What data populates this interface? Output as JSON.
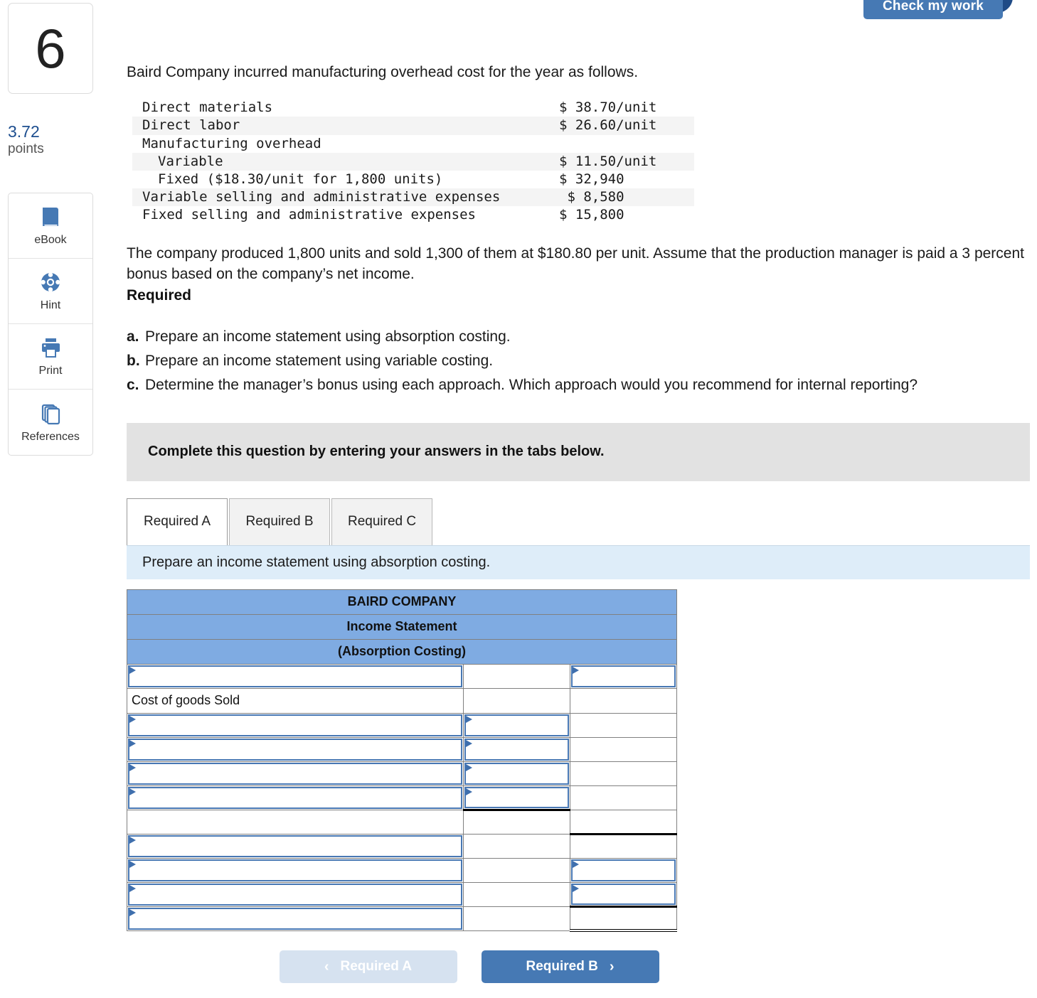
{
  "question": {
    "number": "6",
    "points_value": "3.72",
    "points_label": "points"
  },
  "check_my_work": {
    "label": "Check my work"
  },
  "sidebar": {
    "items": [
      {
        "label": "eBook",
        "icon": "ebook-icon"
      },
      {
        "label": "Hint",
        "icon": "life-ring-icon"
      },
      {
        "label": "Print",
        "icon": "printer-icon"
      },
      {
        "label": "References",
        "icon": "documents-icon"
      }
    ]
  },
  "prompt": {
    "intro": "Baird Company incurred manufacturing overhead cost for the year as follows.",
    "facts": [
      {
        "label": "Direct materials",
        "amount": "$ 38.70/unit",
        "indent": 0,
        "shade": false
      },
      {
        "label": "Direct labor",
        "amount": "$ 26.60/unit",
        "indent": 0,
        "shade": true
      },
      {
        "label": "Manufacturing overhead",
        "amount": "",
        "indent": 0,
        "shade": false
      },
      {
        "label": "Variable",
        "amount": "$ 11.50/unit",
        "indent": 1,
        "shade": true
      },
      {
        "label": "Fixed ($18.30/unit for 1,800 units)",
        "amount": "$ 32,940",
        "indent": 1,
        "shade": false
      },
      {
        "label": "Variable selling and administrative expenses",
        "amount": " $ 8,580",
        "indent": 0,
        "shade": true
      },
      {
        "label": "Fixed selling and administrative expenses",
        "amount": "$ 15,800",
        "indent": 0,
        "shade": false
      }
    ],
    "paragraph": "The company produced 1,800 units and sold 1,300 of them at $180.80 per unit. Assume that the production manager is paid a 3 percent bonus based on the company’s net income.",
    "required_heading": "Required",
    "requirements": [
      {
        "letter": "a.",
        "text": "Prepare an income statement using absorption costing."
      },
      {
        "letter": "b.",
        "text": "Prepare an income statement using variable costing."
      },
      {
        "letter": "c.",
        "text": "Determine the manager’s bonus using each approach. Which approach would you recommend for internal reporting?"
      }
    ]
  },
  "complete_banner": {
    "text": "Complete this question by entering your answers in the tabs below."
  },
  "tabs": [
    {
      "label": "Required A",
      "active": true
    },
    {
      "label": "Required B",
      "active": false
    },
    {
      "label": "Required C",
      "active": false
    }
  ],
  "tab_description": "Prepare an income statement using absorption costing.",
  "income_statement": {
    "header_rows": [
      "BAIRD COMPANY",
      "Income Statement",
      "(Absorption Costing)"
    ],
    "rows": [
      {
        "col1": {
          "type": "input",
          "value": ""
        },
        "col2": {
          "type": "blank"
        },
        "col3": {
          "type": "input",
          "value": ""
        }
      },
      {
        "col1": {
          "type": "text",
          "value": "Cost of goods Sold"
        },
        "col2": {
          "type": "blank"
        },
        "col3": {
          "type": "blank"
        }
      },
      {
        "col1": {
          "type": "input",
          "value": ""
        },
        "col2": {
          "type": "input",
          "value": ""
        },
        "col3": {
          "type": "blank"
        }
      },
      {
        "col1": {
          "type": "input",
          "value": ""
        },
        "col2": {
          "type": "input",
          "value": ""
        },
        "col3": {
          "type": "blank"
        }
      },
      {
        "col1": {
          "type": "input",
          "value": ""
        },
        "col2": {
          "type": "input",
          "value": ""
        },
        "col3": {
          "type": "blank"
        }
      },
      {
        "col1": {
          "type": "input",
          "value": ""
        },
        "col2": {
          "type": "input",
          "value": "",
          "rule": "thick-bottom"
        },
        "col3": {
          "type": "blank"
        }
      },
      {
        "col1": {
          "type": "blank"
        },
        "col2": {
          "type": "blank"
        },
        "col3": {
          "type": "blank",
          "rule": "thick-bottom"
        }
      },
      {
        "col1": {
          "type": "input",
          "value": ""
        },
        "col2": {
          "type": "blank"
        },
        "col3": {
          "type": "blank"
        }
      },
      {
        "col1": {
          "type": "input",
          "value": ""
        },
        "col2": {
          "type": "blank"
        },
        "col3": {
          "type": "input",
          "value": ""
        }
      },
      {
        "col1": {
          "type": "input",
          "value": ""
        },
        "col2": {
          "type": "blank"
        },
        "col3": {
          "type": "input",
          "value": "",
          "rule": "thick-bottom"
        }
      },
      {
        "col1": {
          "type": "input",
          "value": ""
        },
        "col2": {
          "type": "blank"
        },
        "col3": {
          "type": "blank",
          "rule": "dbl-bottom"
        }
      }
    ]
  },
  "navigation": {
    "prev_label": "Required A",
    "next_label": "Required B",
    "prev_chevron": "‹",
    "next_chevron": "›"
  },
  "colors": {
    "header_blue": "#7fabe2",
    "input_border": "#4878b4",
    "accent_blue": "#4679b4",
    "banner_gray": "#e2e2e2",
    "desc_blue": "#deedf9",
    "points_blue": "#1d4e8f"
  }
}
